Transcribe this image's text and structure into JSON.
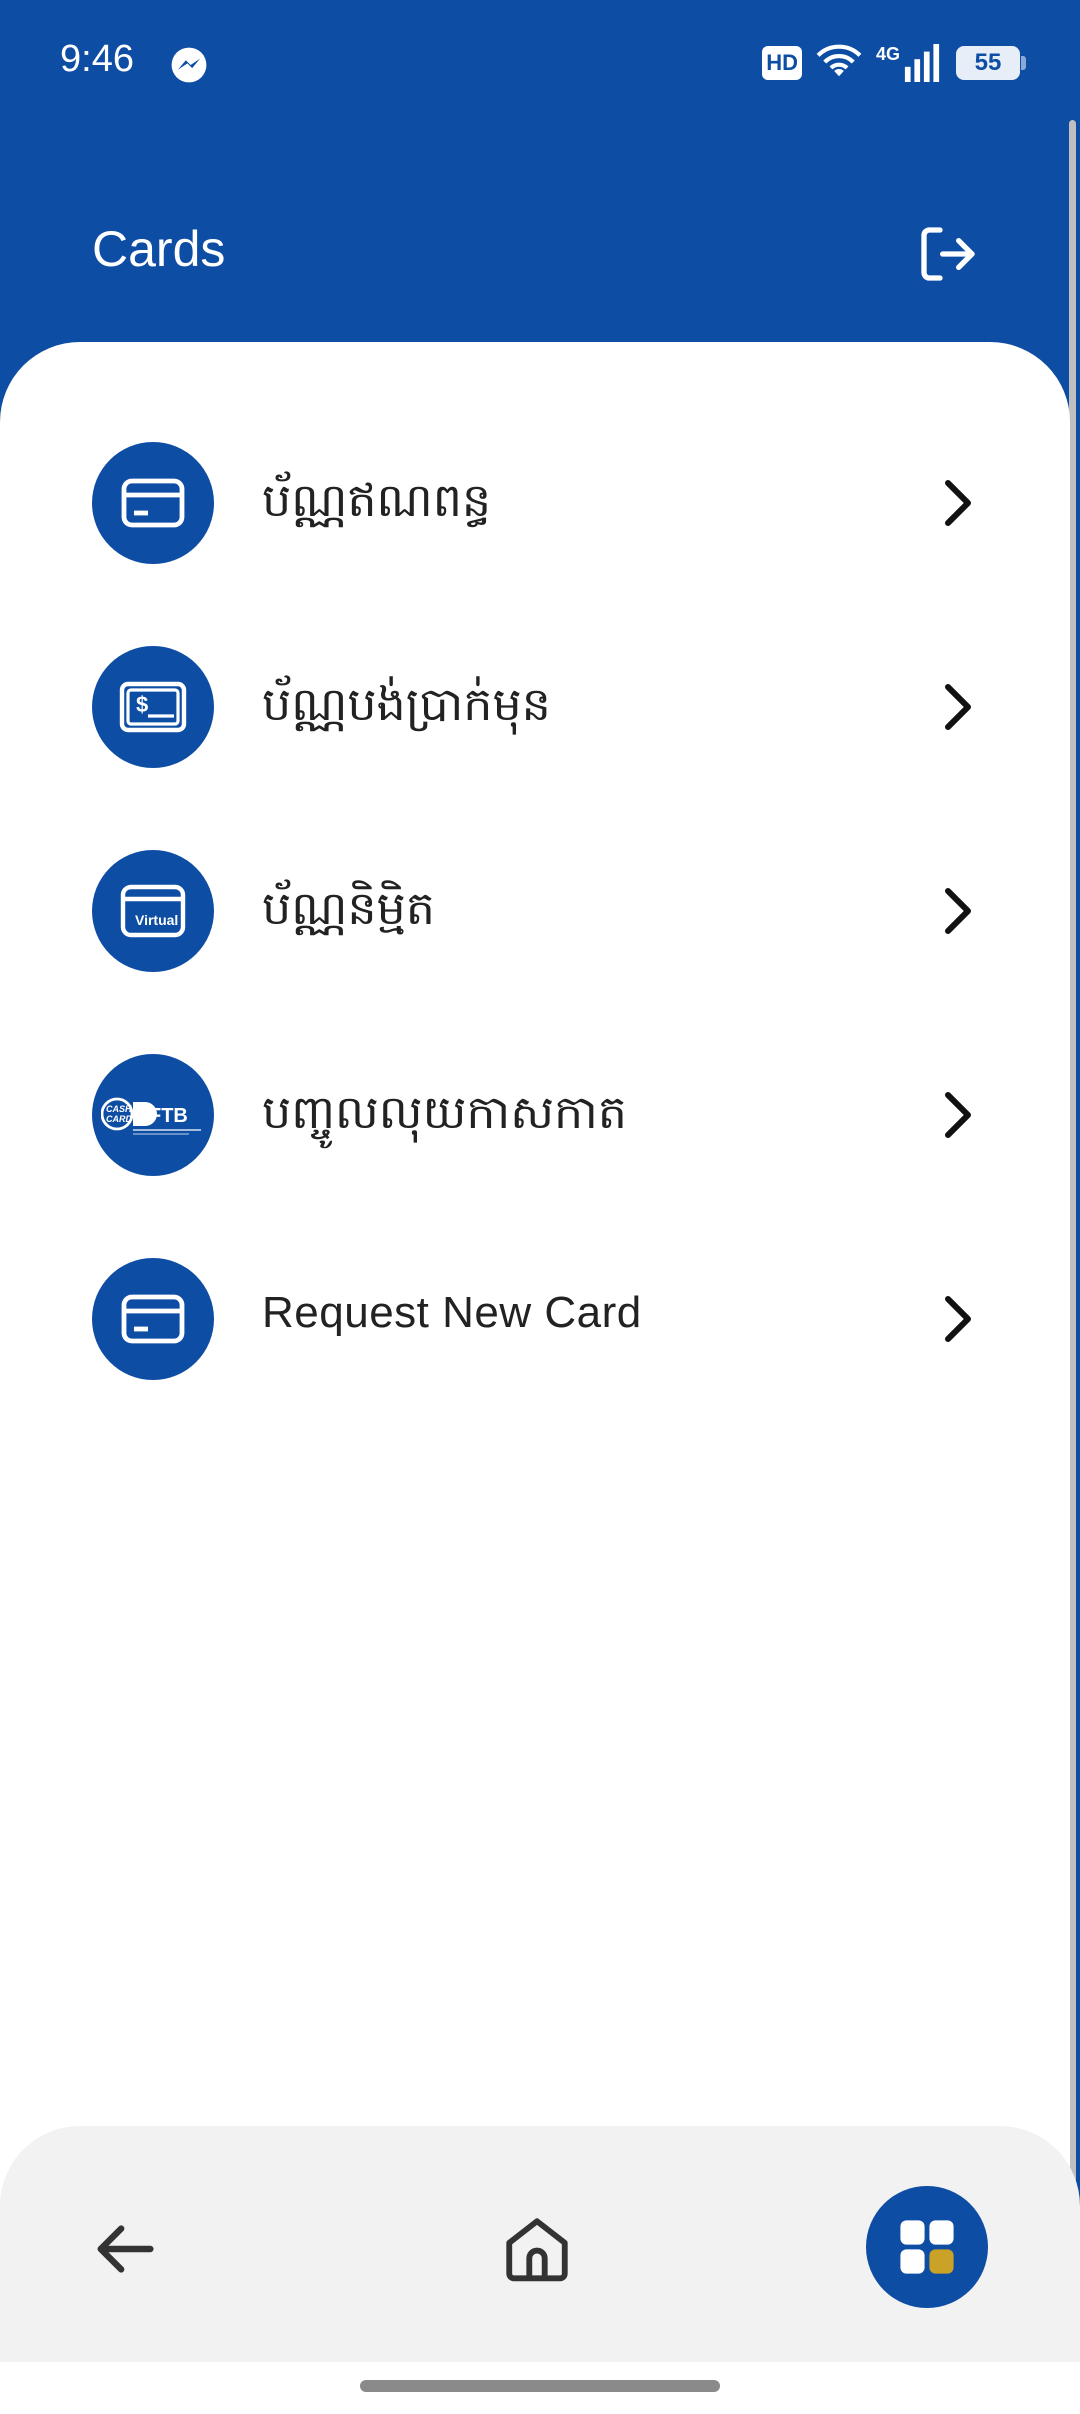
{
  "status_bar": {
    "time": "9:46",
    "network": "4G",
    "hd_label": "HD",
    "battery": "55"
  },
  "header": {
    "title": "Cards"
  },
  "menu": {
    "items": [
      {
        "label": "ប័ណ្ណឥណពន្ធ",
        "icon": "credit-card-icon"
      },
      {
        "label": "ប័ណ្ណបង់ប្រាក់មុន",
        "icon": "prepaid-card-icon"
      },
      {
        "label": "ប័ណ្ណនិម្មិត",
        "icon": "virtual-card-icon",
        "icon_text": "Virtual"
      },
      {
        "label": "បញ្ចូលលុយកាសកាត",
        "icon": "cash-card-ftb-logo",
        "icon_text": "FTB"
      },
      {
        "label": "Request New Card",
        "icon": "credit-card-icon"
      }
    ]
  },
  "colors": {
    "primary": "#0E4DA4",
    "accent": "#C9A227",
    "background": "#FFFFFF",
    "nav_background": "#F2F2F2"
  }
}
